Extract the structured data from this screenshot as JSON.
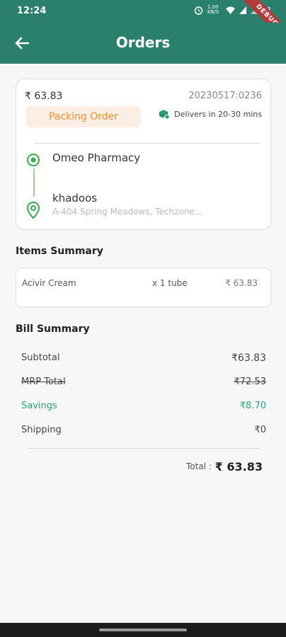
{
  "status_bar": {
    "time": "12:24",
    "data_rate": "1.00 KB/S",
    "battery": "21"
  },
  "debug_banner": "DEBUG",
  "app_bar": {
    "title": "Orders",
    "back_icon": "arrow-back-icon"
  },
  "order": {
    "price": "₹ 63.83",
    "order_id": "20230517:0236",
    "status": "Packing Order",
    "delivery_text": "Delivers in 20-30 mins",
    "store_name": "Omeo Pharmacy",
    "customer_name": "khadoos",
    "customer_address": "A-404 Spring Meadows, Techzone..."
  },
  "items_summary": {
    "title": "Items Summary",
    "items": [
      {
        "name": "Acivir Cream",
        "qty": "x 1 tube",
        "price": "₹ 63.83"
      }
    ]
  },
  "bill_summary": {
    "title": "Bill Summary",
    "rows": [
      {
        "label": "Subtotal",
        "value": "₹63.83"
      },
      {
        "label": "MRP Total",
        "value": "₹72.53"
      },
      {
        "label": "Savings",
        "value": "₹8.70"
      },
      {
        "label": "Shipping",
        "value": "₹0"
      }
    ],
    "total_label": "Total :",
    "total_value": "₹ 63.83"
  },
  "colors": {
    "primary": "#2b7f6d",
    "status_orange": "#f0912e",
    "status_bg": "#fdeee4",
    "savings_green": "#2aa37c",
    "pin_green": "#3aa84a"
  }
}
